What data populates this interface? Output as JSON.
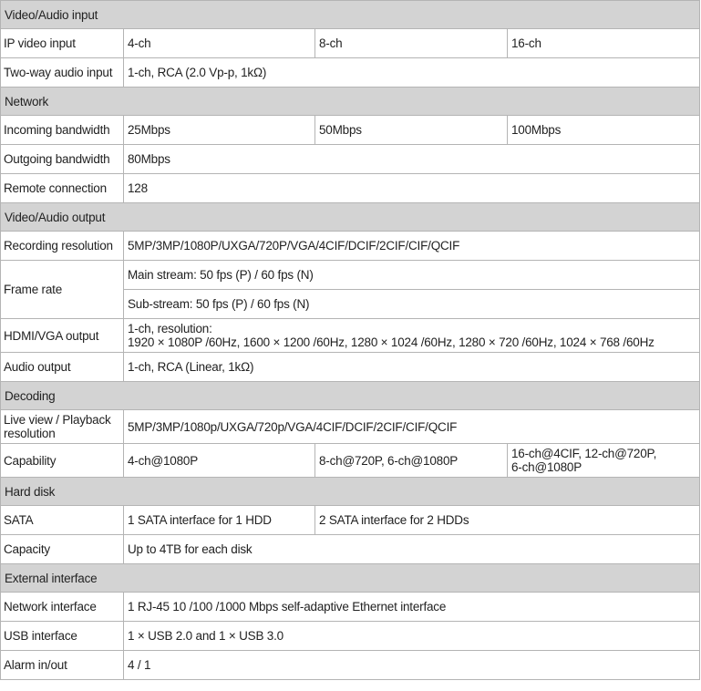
{
  "sections": [
    {
      "title": "Video/Audio input",
      "rows": [
        {
          "label": "IP video input",
          "values": [
            "4-ch",
            "8-ch",
            "16-ch"
          ]
        },
        {
          "label": "Two-way audio input",
          "values": [
            "1-ch, RCA (2.0 Vp-p, 1kΩ)"
          ]
        }
      ]
    },
    {
      "title": "Network",
      "rows": [
        {
          "label": "Incoming bandwidth",
          "values": [
            "25Mbps",
            "50Mbps",
            "100Mbps"
          ]
        },
        {
          "label": "Outgoing bandwidth",
          "values": [
            "80Mbps"
          ]
        },
        {
          "label": "Remote connection",
          "values": [
            "128"
          ]
        }
      ]
    },
    {
      "title": "Video/Audio output",
      "rows": [
        {
          "label": "Recording resolution",
          "values": [
            "5MP/3MP/1080P/UXGA/720P/VGA/4CIF/DCIF/2CIF/CIF/QCIF"
          ]
        },
        {
          "label": "Frame rate",
          "values": [
            "Main stream: 50 fps (P) / 60 fps (N)",
            "Sub-stream: 50 fps (P) / 60 fps (N)"
          ]
        },
        {
          "label": "HDMI/VGA output",
          "values": [
            "1-ch, resolution:",
            "1920 × 1080P /60Hz, 1600 × 1200 /60Hz, 1280 × 1024 /60Hz, 1280 × 720 /60Hz, 1024 × 768 /60Hz"
          ]
        },
        {
          "label": "Audio output",
          "values": [
            "1-ch, RCA (Linear, 1kΩ)"
          ]
        }
      ]
    },
    {
      "title": "Decoding",
      "rows": [
        {
          "label": [
            "Live view / Playback",
            "resolution"
          ],
          "values": [
            "5MP/3MP/1080p/UXGA/720p/VGA/4CIF/DCIF/2CIF/CIF/QCIF"
          ]
        },
        {
          "label": "Capability",
          "values": [
            "4-ch@1080P",
            "8-ch@720P, 6-ch@1080P",
            [
              "16-ch@4CIF, 12-ch@720P,",
              "6-ch@1080P"
            ]
          ]
        }
      ]
    },
    {
      "title": "Hard disk",
      "rows": [
        {
          "label": "SATA",
          "values": [
            "1 SATA interface for 1 HDD",
            "2 SATA interface for 2 HDDs"
          ]
        },
        {
          "label": "Capacity",
          "values": [
            "Up to 4TB for each disk"
          ]
        }
      ]
    },
    {
      "title": "External interface",
      "rows": [
        {
          "label": "Network interface",
          "values": [
            "1 RJ-45 10 /100 /1000 Mbps self-adaptive Ethernet interface"
          ]
        },
        {
          "label": "USB interface",
          "values": [
            "1 × USB 2.0 and 1 × USB 3.0"
          ]
        },
        {
          "label": "Alarm in/out",
          "values": [
            "4 / 1"
          ]
        }
      ]
    }
  ]
}
